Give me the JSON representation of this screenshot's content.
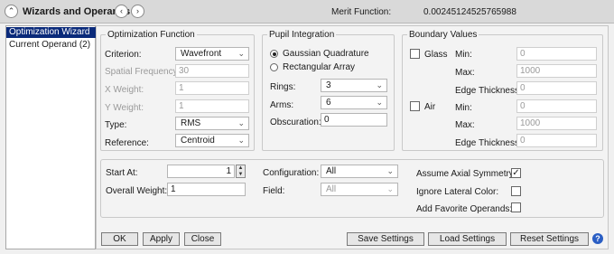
{
  "titlebar": {
    "title": "Wizards and Operands",
    "merit_label": "Merit Function:",
    "merit_value": "0.00245124525765988"
  },
  "nav": {
    "items": [
      {
        "label": "Optimization Wizard",
        "selected": true
      },
      {
        "label": "Current Operand (2)",
        "selected": false
      }
    ]
  },
  "optimization_function": {
    "legend": "Optimization Function",
    "criterion_label": "Criterion:",
    "criterion_value": "Wavefront",
    "spatial_freq_label": "Spatial Frequency:",
    "spatial_freq_value": "30",
    "x_weight_label": "X Weight:",
    "x_weight_value": "1",
    "y_weight_label": "Y Weight:",
    "y_weight_value": "1",
    "type_label": "Type:",
    "type_value": "RMS",
    "reference_label": "Reference:",
    "reference_value": "Centroid"
  },
  "pupil_integration": {
    "legend": "Pupil Integration",
    "gaussian_label": "Gaussian Quadrature",
    "rectangular_label": "Rectangular Array",
    "rings_label": "Rings:",
    "rings_value": "3",
    "arms_label": "Arms:",
    "arms_value": "6",
    "obscuration_label": "Obscuration:",
    "obscuration_value": "0"
  },
  "boundary_values": {
    "legend": "Boundary Values",
    "glass_label": "Glass",
    "air_label": "Air",
    "min_label": "Min:",
    "max_label": "Max:",
    "edge_label": "Edge Thickness:",
    "glass_min": "0",
    "glass_max": "1000",
    "glass_edge": "0",
    "air_min": "0",
    "air_max": "1000",
    "air_edge": "0"
  },
  "settings": {
    "start_at_label": "Start At:",
    "start_at_value": "1",
    "overall_weight_label": "Overall Weight:",
    "overall_weight_value": "1",
    "configuration_label": "Configuration:",
    "configuration_value": "All",
    "field_label": "Field:",
    "field_value": "All",
    "assume_axial_label": "Assume Axial Symmetry:",
    "ignore_lateral_label": "Ignore Lateral Color:",
    "add_favorite_label": "Add Favorite Operands:",
    "checkmark": "✓"
  },
  "buttons": {
    "ok": "OK",
    "apply": "Apply",
    "close": "Close",
    "save_settings": "Save Settings",
    "load_settings": "Load Settings",
    "reset_settings": "Reset Settings",
    "help": "?"
  },
  "icons": {
    "collapse": "⌃",
    "back": "‹",
    "forward": "›",
    "chevron": "⌄",
    "spin_up": "▲",
    "spin_down": "▼"
  }
}
